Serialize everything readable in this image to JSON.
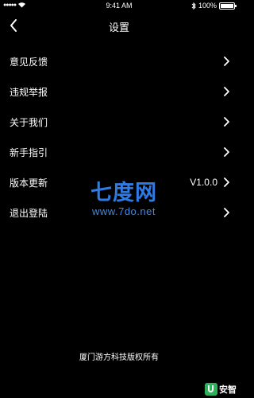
{
  "status_bar": {
    "time": "9:41 AM",
    "battery": "100%",
    "signal_icon": "signal-dots-icon",
    "wifi_icon": "wifi-icon",
    "bluetooth_icon": "bluetooth-icon"
  },
  "nav": {
    "title": "设置",
    "back_icon": "chevron-left-icon"
  },
  "menu": {
    "items": [
      {
        "label": "意见反馈",
        "value": ""
      },
      {
        "label": "违规举报",
        "value": ""
      },
      {
        "label": "关于我们",
        "value": ""
      },
      {
        "label": "新手指引",
        "value": ""
      },
      {
        "label": "版本更新",
        "value": "V1.0.0"
      },
      {
        "label": "退出登陆",
        "value": ""
      }
    ]
  },
  "watermark": {
    "title": "七度网",
    "url": "www.7do.net",
    "color": "#2f7be3"
  },
  "footer": {
    "copyright": "厦门游方科技版权所有"
  },
  "badge": {
    "text": "安智",
    "color": "#2cb35a"
  }
}
